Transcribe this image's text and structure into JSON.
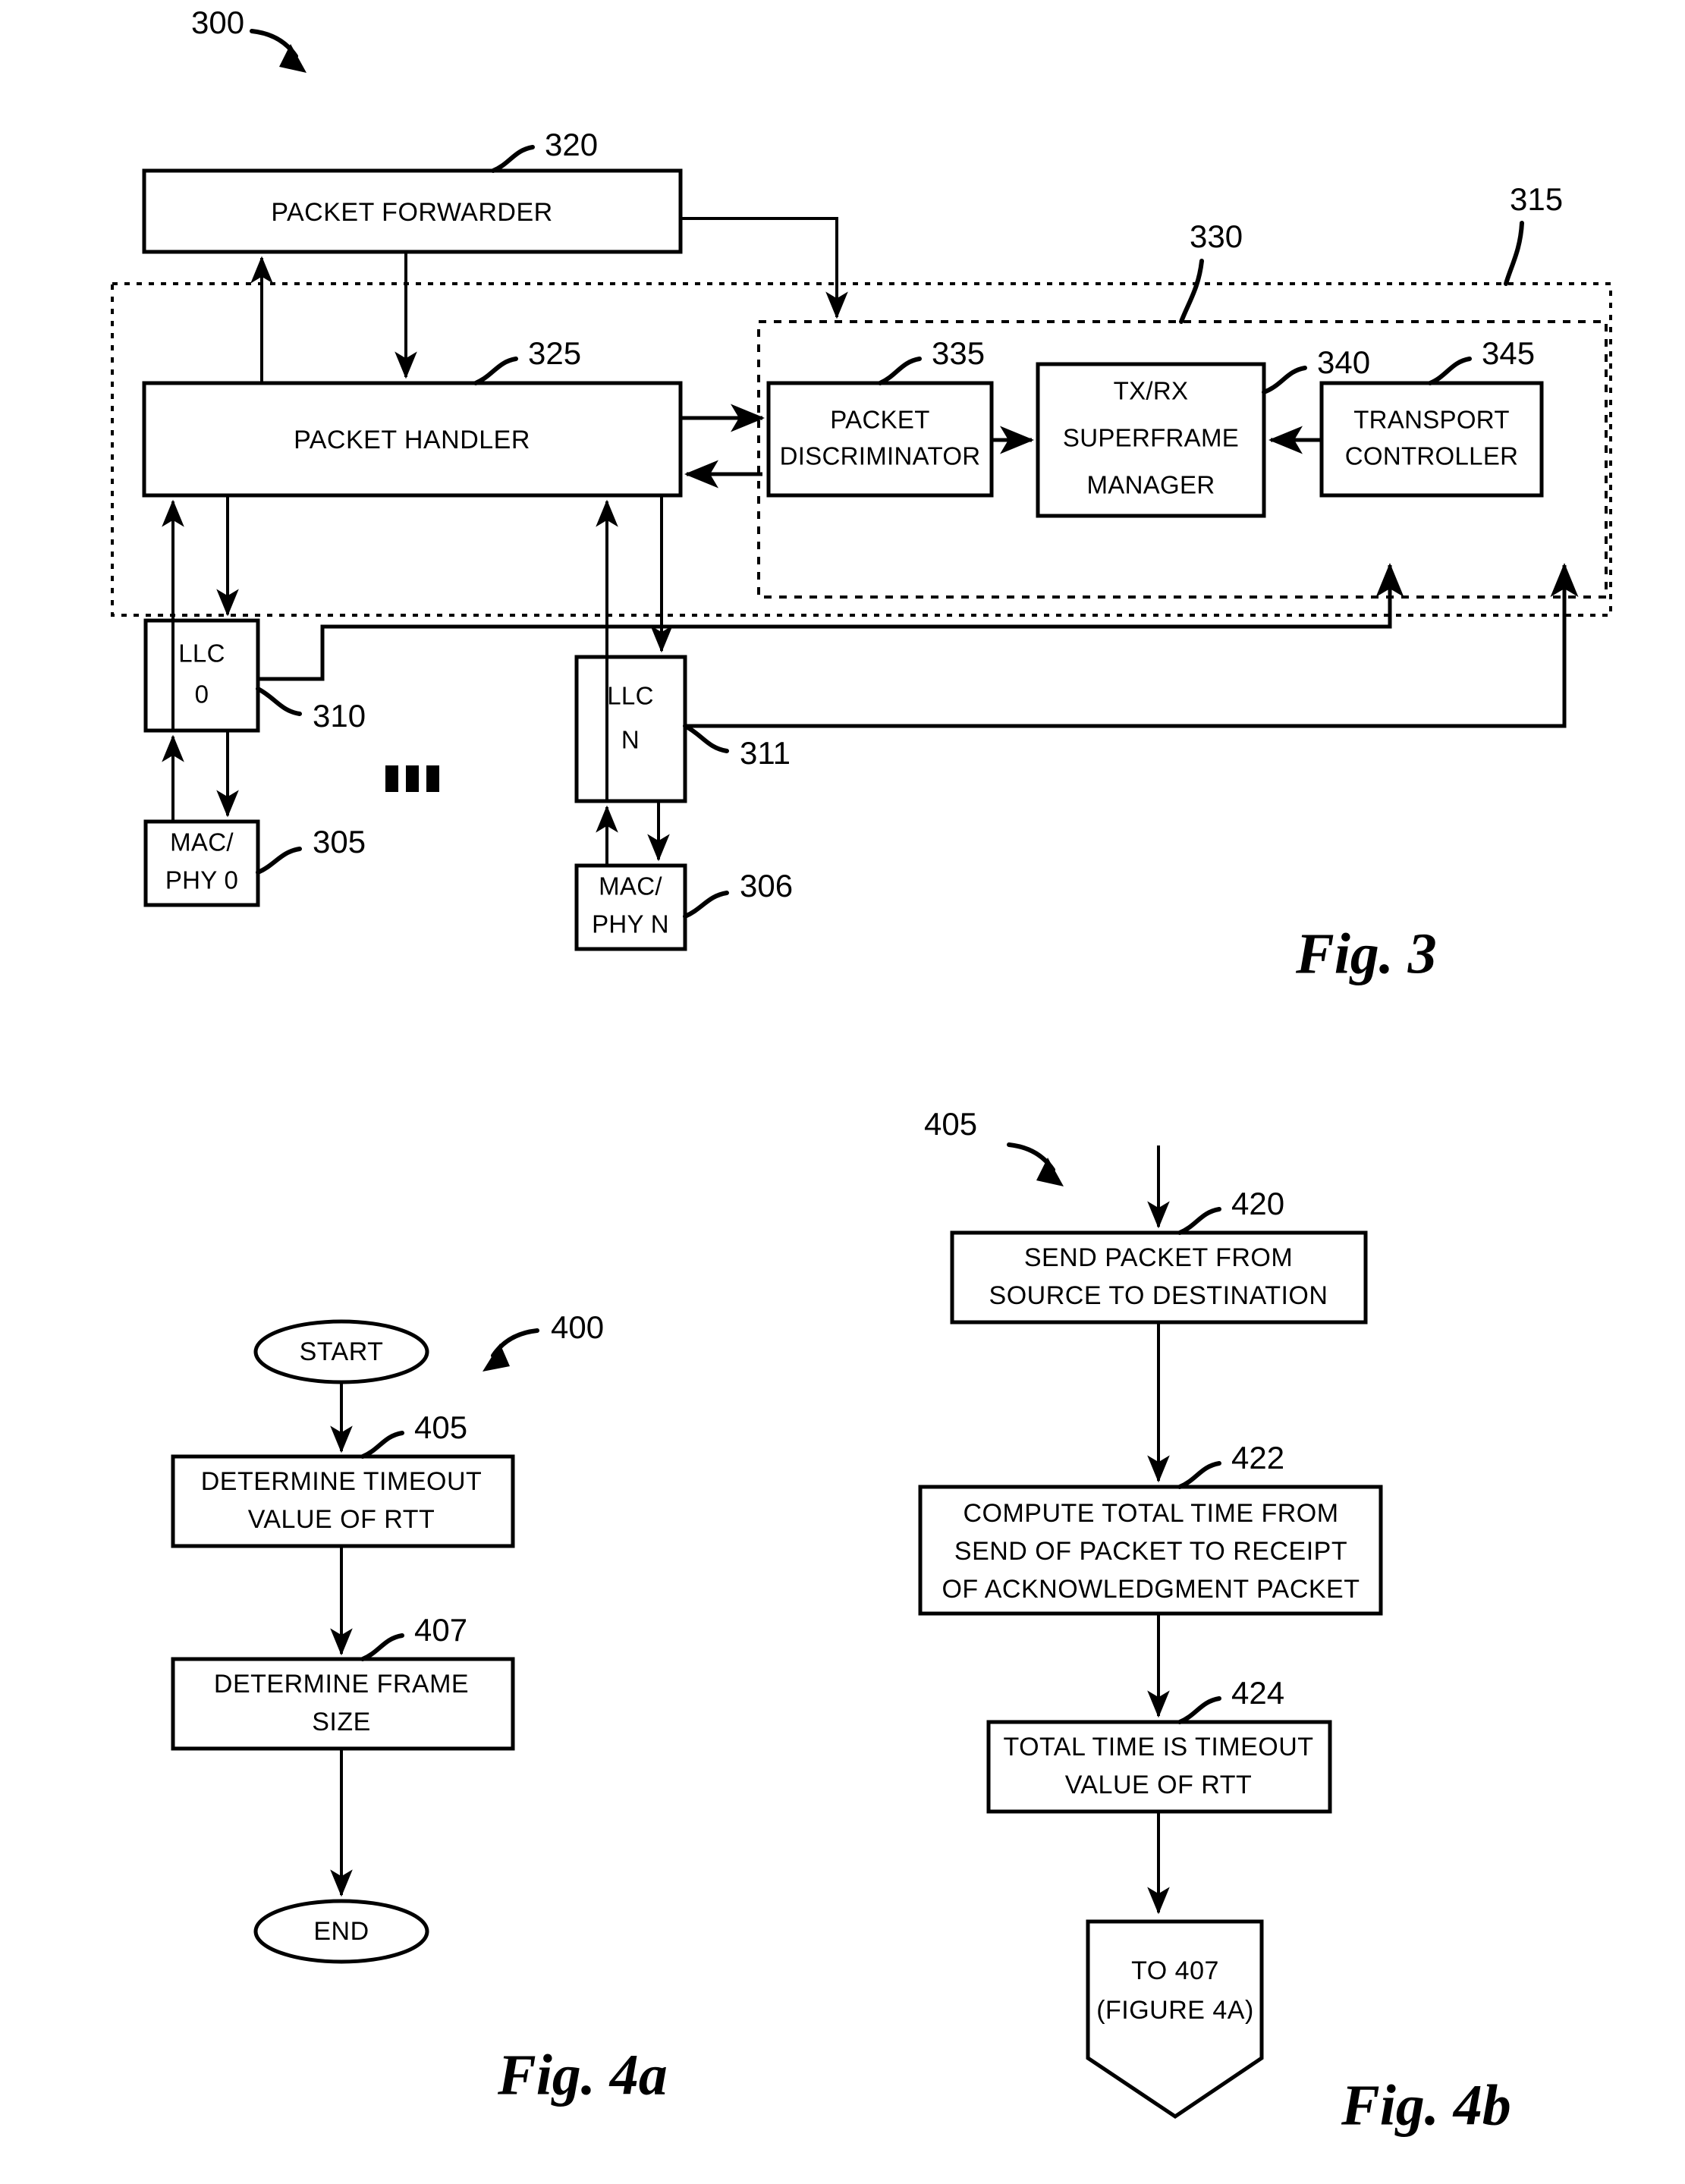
{
  "figure3": {
    "ref": "300",
    "caption": "Fig. 3",
    "boxes": {
      "packet_forwarder": {
        "label": "PACKET FORWARDER",
        "ref": "320"
      },
      "packet_handler": {
        "label": "PACKET HANDLER",
        "ref": "325"
      },
      "packet_discriminator": {
        "label_line1": "PACKET",
        "label_line2": "DISCRIMINATOR",
        "ref": "335"
      },
      "superframe_manager": {
        "label_line1": "TX/RX",
        "label_line2": "SUPERFRAME",
        "label_line3": "MANAGER",
        "ref": "340"
      },
      "transport_controller": {
        "label_line1": "TRANSPORT",
        "label_line2": "CONTROLLER",
        "ref": "345"
      },
      "llc0": {
        "label_line1": "LLC",
        "label_line2": "0",
        "ref": "310"
      },
      "llcn": {
        "label_line1": "LLC",
        "label_line2": "N",
        "ref": "311"
      },
      "macphy0": {
        "label_line1": "MAC/",
        "label_line2": "PHY 0",
        "ref": "305"
      },
      "macphyn": {
        "label_line1": "MAC/",
        "label_line2": "PHY N",
        "ref": "306"
      }
    },
    "groups": {
      "outer": {
        "ref": "315"
      },
      "inner": {
        "ref": "330"
      }
    },
    "ellipsis": "•••"
  },
  "figure4a": {
    "ref": "400",
    "caption": "Fig. 4a",
    "nodes": {
      "start": {
        "label": "START"
      },
      "step405": {
        "label_line1": "DETERMINE TIMEOUT",
        "label_line2": "VALUE OF RTT",
        "ref": "405"
      },
      "step407": {
        "label_line1": "DETERMINE FRAME",
        "label_line2": "SIZE",
        "ref": "407"
      },
      "end": {
        "label": "END"
      }
    }
  },
  "figure4b": {
    "ref": "405",
    "caption": "Fig. 4b",
    "nodes": {
      "step420": {
        "label_line1": "SEND PACKET FROM",
        "label_line2": "SOURCE TO DESTINATION",
        "ref": "420"
      },
      "step422": {
        "label_line1": "COMPUTE TOTAL TIME FROM",
        "label_line2": "SEND OF PACKET TO RECEIPT",
        "label_line3": "OF ACKNOWLEDGMENT PACKET",
        "ref": "422"
      },
      "step424": {
        "label_line1": "TOTAL TIME IS TIMEOUT",
        "label_line2": "VALUE OF RTT",
        "ref": "424"
      },
      "connector": {
        "label_line1": "TO 407",
        "label_line2": "(FIGURE 4A)"
      }
    }
  },
  "colors": {
    "ink": "#000000",
    "paper": "#ffffff"
  }
}
